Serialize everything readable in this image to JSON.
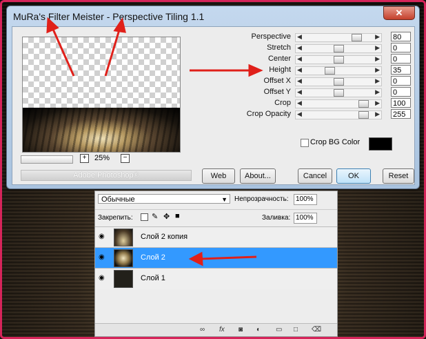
{
  "dialog": {
    "title": "MuRa's Filter Meister - Perspective Tiling 1.1",
    "close_symbol": "✕",
    "zoom_value": "25%",
    "zoom_plus": "+",
    "zoom_minus": "−",
    "ps_label": "Adobe Photoshop®",
    "params": [
      {
        "label": "Perspective",
        "value": "80",
        "level": 0.8
      },
      {
        "label": "Stretch",
        "value": "0",
        "level": 0.5
      },
      {
        "label": "Center",
        "value": "0",
        "level": 0.5
      },
      {
        "label": "Height",
        "value": "35",
        "level": 0.35
      },
      {
        "label": "Offset X",
        "value": "0",
        "level": 0.5
      },
      {
        "label": "Offset Y",
        "value": "0",
        "level": 0.5
      },
      {
        "label": "Crop",
        "value": "100",
        "level": 0.92
      },
      {
        "label": "Crop Opacity",
        "value": "255",
        "level": 0.92
      }
    ],
    "crop_bg_label": "Crop BG Color",
    "crop_bg_color": "#000000",
    "buttons": {
      "web": "Web",
      "about": "About...",
      "cancel": "Cancel",
      "ok": "OK",
      "reset": "Reset"
    }
  },
  "layers_panel": {
    "blend_mode": "Обычные",
    "opacity_label": "Непрозрачность:",
    "opacity_value": "100%",
    "lock_label": "Закрепить:",
    "fill_label": "Заливка:",
    "fill_value": "100%",
    "layers": [
      {
        "name": "Слой 2 копия",
        "active": false
      },
      {
        "name": "Слой 2",
        "active": true
      },
      {
        "name": "Слой 1",
        "active": false
      }
    ],
    "footer_icons": [
      "link-icon",
      "fx-icon",
      "mask-icon",
      "adjustment-icon",
      "folder-icon",
      "new-layer-icon",
      "trash-icon"
    ]
  },
  "colors": {
    "frame": "#d6245a",
    "active_layer": "#3399ff",
    "arrow": "#e0201a"
  }
}
